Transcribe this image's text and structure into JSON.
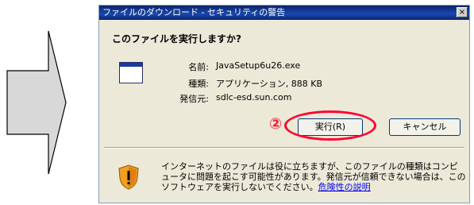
{
  "dialog": {
    "title": "ファイルのダウンロード - セキュリティの警告",
    "close_label": "×",
    "question": "このファイルを実行しますか?",
    "fields": [
      {
        "label": "名前:",
        "value": "JavaSetup6u26.exe"
      },
      {
        "label": "種類:",
        "value": "アプリケーション, 888 KB"
      },
      {
        "label": "発信元:",
        "value": "sdlc-esd.sun.com"
      }
    ],
    "run_button": "実行(R)",
    "cancel_button": "キャンセル",
    "warning_text": "インターネットのファイルは役に立ちますが、このファイルの種類はコンピュータに問題を起こす可能性があります。発信元が信頼できない場合は、このソフトウェアを実行しないでください。",
    "warning_link": "危険性の説明"
  },
  "annotation": {
    "step_number": "②",
    "color": "#ff0033"
  },
  "colors": {
    "titlebar": "#0a246a",
    "dialog_bg": "#ece9d8",
    "link": "#0000ee"
  }
}
